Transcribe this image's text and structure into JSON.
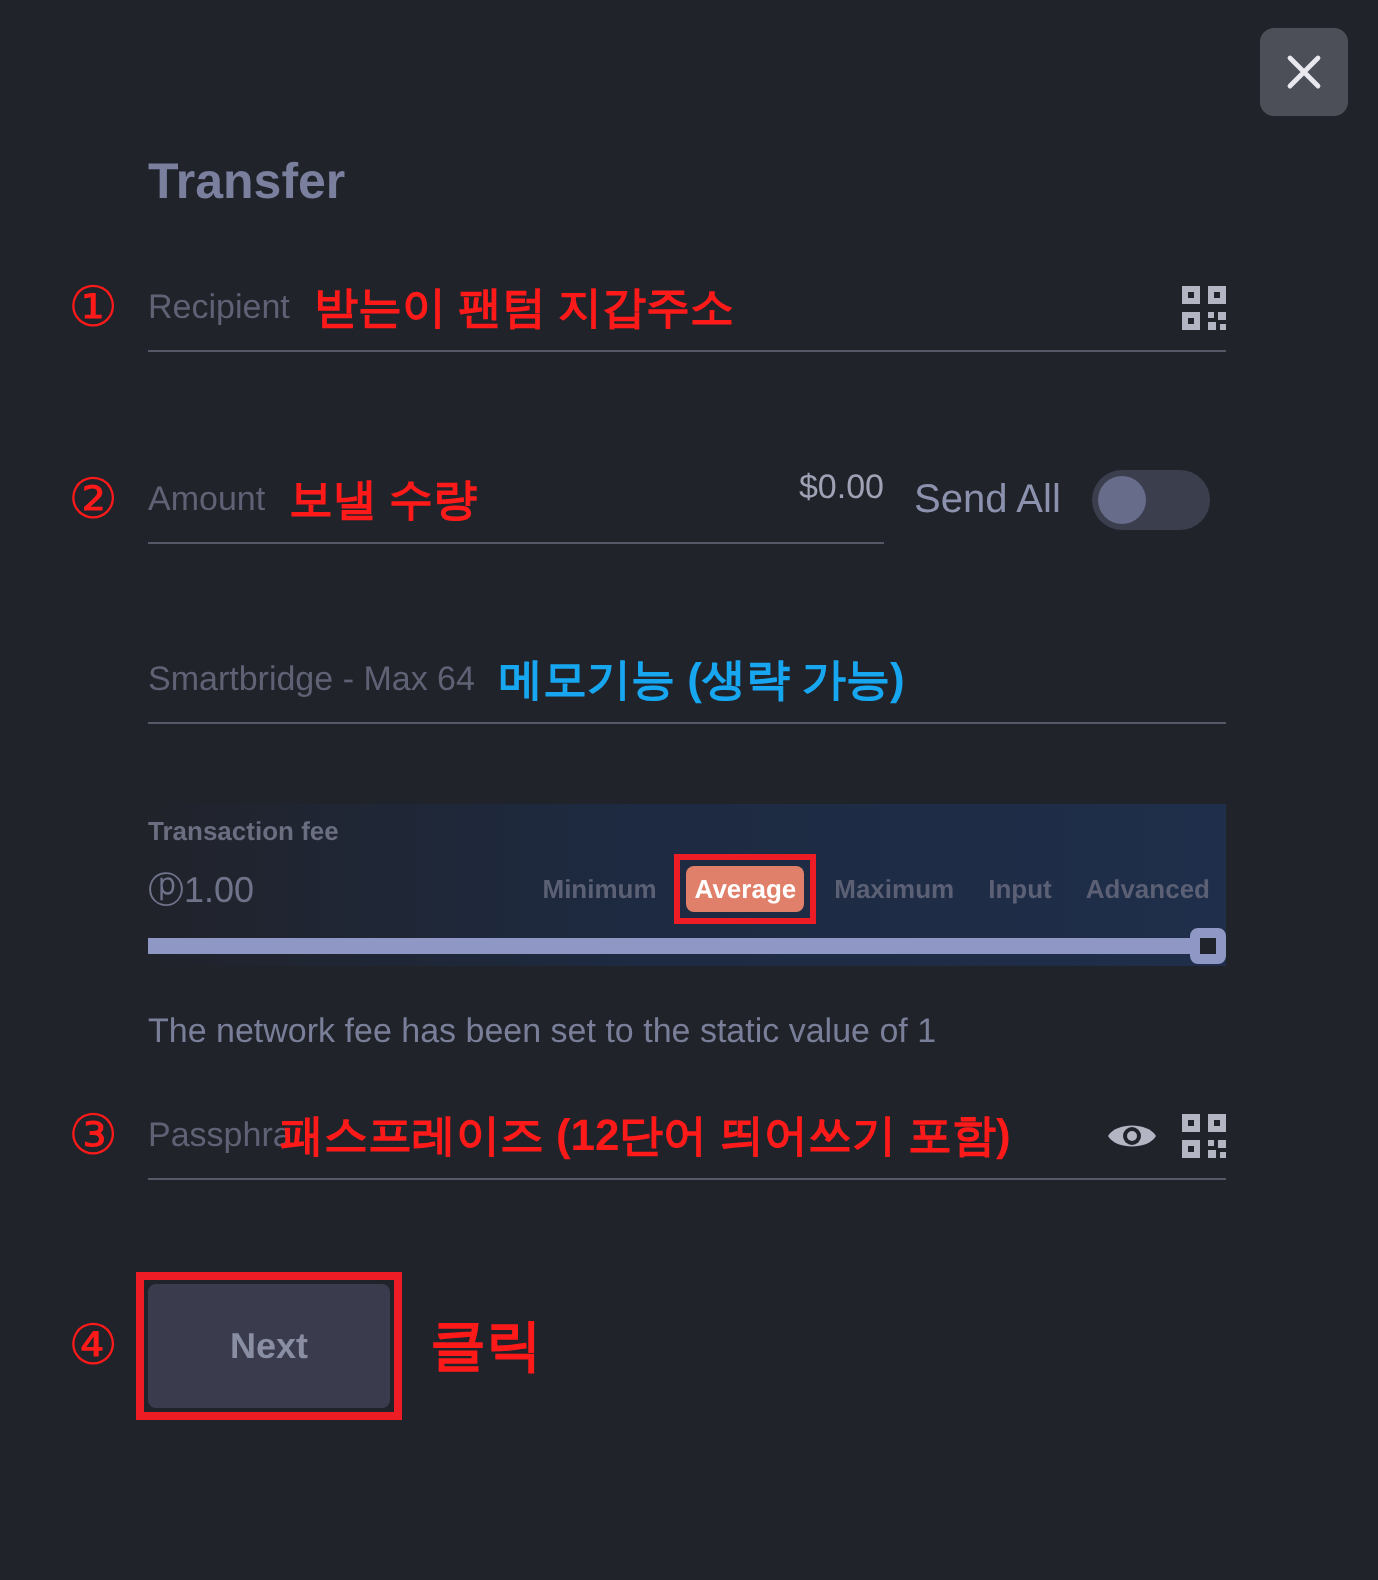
{
  "title": "Transfer",
  "recipient": {
    "marker": "①",
    "placeholder": "Recipient",
    "annotation": {
      "text": "받는이 팬텀 지갑주소",
      "color": "#ff1a1a"
    }
  },
  "amount": {
    "marker": "②",
    "placeholder": "Amount",
    "annotation": {
      "text": "보낼 수량",
      "color": "#ff1a1a"
    },
    "value": "$0.00"
  },
  "send_all": {
    "label": "Send All",
    "on": false
  },
  "smartbridge": {
    "placeholder": "Smartbridge - Max 64",
    "annotation": {
      "text": "메모기능 (생략 가능)",
      "color": "#17a6f0"
    }
  },
  "fee": {
    "label": "Transaction fee",
    "value": "ⓟ1.00",
    "level": 1,
    "options": [
      {
        "label": "Minimum",
        "selected": false,
        "framed": false
      },
      {
        "label": "Average",
        "selected": true,
        "framed": true
      },
      {
        "label": "Maximum",
        "selected": false,
        "framed": false
      },
      {
        "label": "Input",
        "selected": false,
        "framed": false
      },
      {
        "label": "Advanced",
        "selected": false,
        "framed": false
      }
    ]
  },
  "notice": "The network fee has been set to the static value of 1",
  "passphrase": {
    "marker": "③",
    "placeholder": "Passphra",
    "annotation": {
      "text": "패스프레이즈 (12단어 띄어쓰기 포함)",
      "color": "#ff1a1a"
    }
  },
  "next": {
    "marker": "④",
    "label": "Next",
    "framed": true,
    "annotation": {
      "text": "클릭",
      "color": "#ff1a1a"
    }
  }
}
